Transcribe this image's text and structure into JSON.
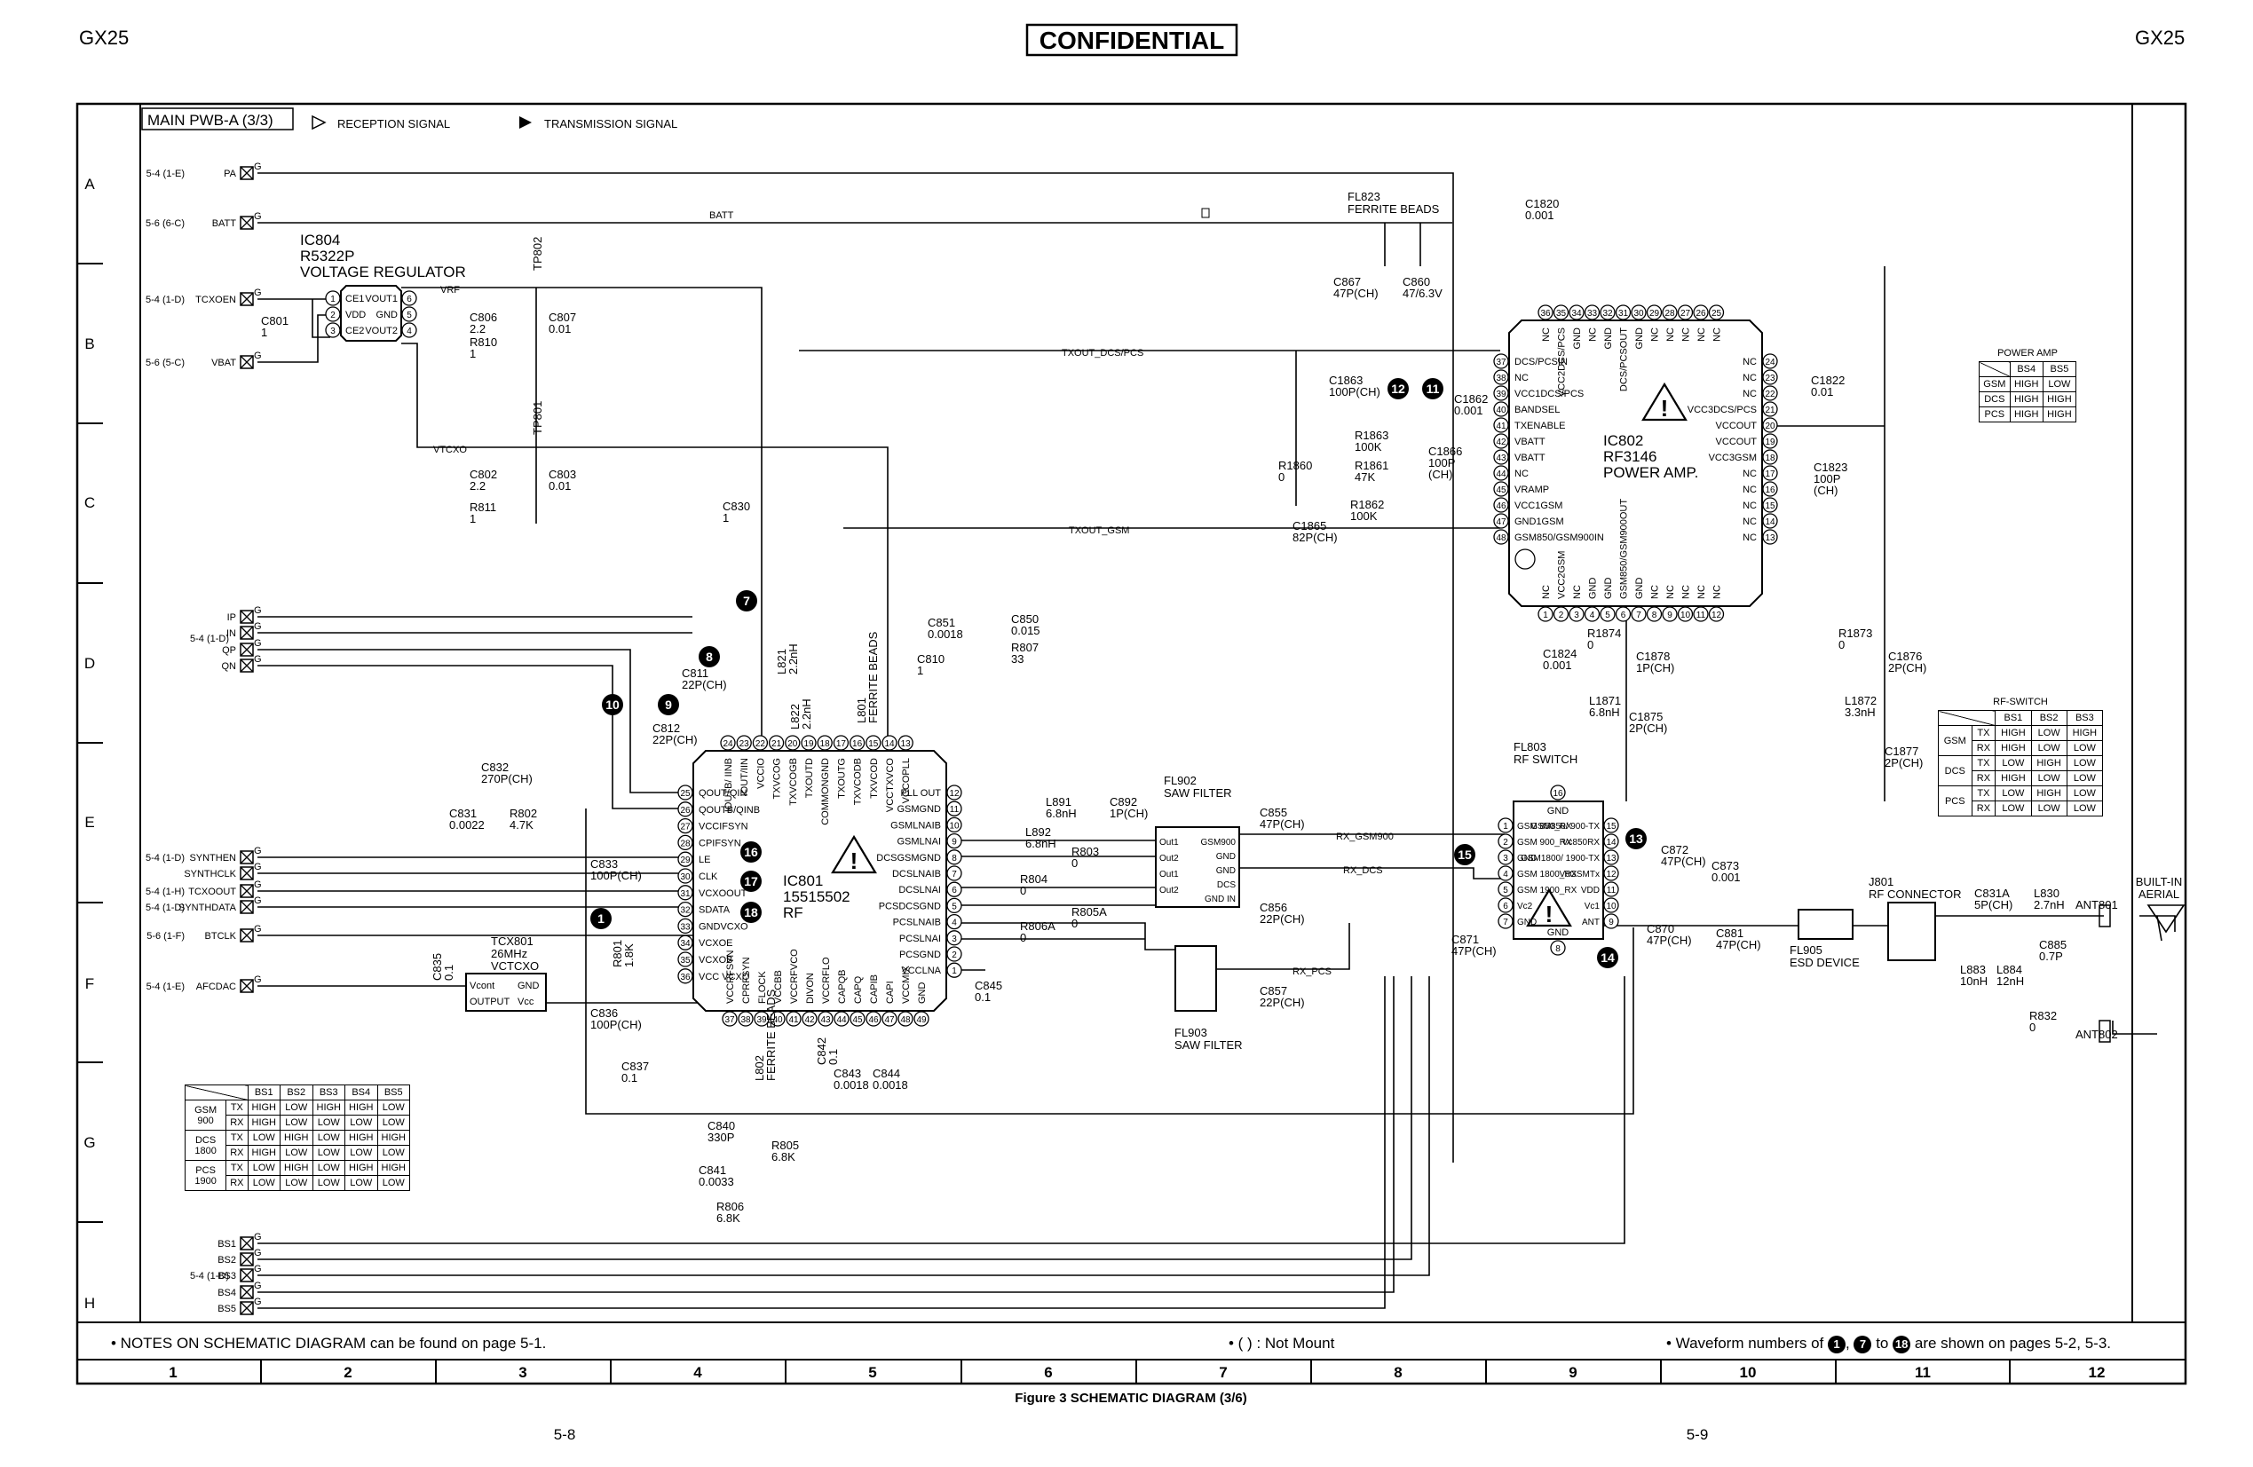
{
  "header": {
    "model_left": "GX25",
    "model_right": "GX25",
    "confidential": "CONFIDENTIAL"
  },
  "frame": {
    "sheet_title": "MAIN PWB-A (3/3)",
    "legend_reception": "RECEPTION SIGNAL",
    "legend_transmission": "TRANSMISSION SIGNAL",
    "rows": [
      "A",
      "B",
      "C",
      "D",
      "E",
      "F",
      "G",
      "H"
    ],
    "cols": [
      "1",
      "2",
      "3",
      "4",
      "5",
      "6",
      "7",
      "8",
      "9",
      "10",
      "11",
      "12"
    ]
  },
  "connectors": {
    "pa": [
      "5-4 (1-E)",
      "PA"
    ],
    "batt": [
      "5-6 (6-C)",
      "BATT"
    ],
    "tcxoen": [
      "5-4 (1-D)",
      "TCXOEN"
    ],
    "vbat": [
      "5-6 (5-C)",
      "VBAT"
    ],
    "iq_ref": "5-4 (1-D)",
    "iq": [
      "IP",
      "IN",
      "QP",
      "QN"
    ],
    "synth": [
      [
        "5-4 (1-D)",
        "SYNTHEN"
      ],
      [
        "",
        "SYNTHCLK"
      ],
      [
        "5-4 (1-H)",
        "TCXOOUT"
      ],
      [
        "5-4 (1-D)",
        "SYNTHDATA"
      ]
    ],
    "btclk": [
      "5-6 (1-F)",
      "BTCLK"
    ],
    "afcdac": [
      "5-4 (1-E)",
      "AFCDAC"
    ],
    "bs_ref": "5-4 (1-D)",
    "bs": [
      "BS1",
      "BS2",
      "BS3",
      "BS4",
      "BS5"
    ],
    "ground_mark": "G"
  },
  "nets": {
    "vrf": "VRF",
    "vtcxo": "VTCXO",
    "batt": "BATT",
    "txout_dcs_pcs": "TXOUT_DCS/PCS",
    "txout_gsm": "TXOUT_GSM",
    "rx_gsm900": "RX_GSM900",
    "rx_dcs": "RX_DCS",
    "rx_pcs": "RX_PCS",
    "nc": "NC"
  },
  "ic804": {
    "ref": "IC804",
    "part": "R5322P",
    "desc": "VOLTAGE REGULATOR",
    "left": [
      [
        "1",
        "CE1"
      ],
      [
        "2",
        "VDD"
      ],
      [
        "3",
        "CE2"
      ]
    ],
    "right": [
      [
        "6",
        "VOUT1"
      ],
      [
        "5",
        "GND"
      ],
      [
        "4",
        "VOUT2"
      ]
    ]
  },
  "ic801": {
    "ref": "IC801",
    "part": "15515502",
    "desc": "RF",
    "top": [
      [
        "24",
        "IOUTB/ IINB"
      ],
      [
        "23",
        "IOUT/IIN"
      ],
      [
        "22",
        "VCCIO"
      ],
      [
        "21",
        "TXVCOG"
      ],
      [
        "20",
        "TXVCOGB"
      ],
      [
        "19",
        "TXOUTD"
      ],
      [
        "18",
        "COMMONGND"
      ],
      [
        "17",
        "TXOUTG"
      ],
      [
        "16",
        "TXVCODB"
      ],
      [
        "15",
        "TXVCOD"
      ],
      [
        "14",
        "VCCTXVCO"
      ],
      [
        "13",
        "VCCOPLL"
      ]
    ],
    "left": [
      [
        "25",
        "QOUT/QIN"
      ],
      [
        "26",
        "QOUTB/QINB"
      ],
      [
        "27",
        "VCCIFSYN"
      ],
      [
        "28",
        "CPIFSYN"
      ],
      [
        "29",
        "LE"
      ],
      [
        "30",
        "CLK"
      ],
      [
        "31",
        "VCXOOUT"
      ],
      [
        "32",
        "SDATA"
      ],
      [
        "33",
        "GNDVCXO"
      ],
      [
        "34",
        "VCXOE"
      ],
      [
        "35",
        "VCXOB"
      ],
      [
        "36",
        "VCC VCXO"
      ]
    ],
    "bottom": [
      [
        "37",
        "VCCRFSYN"
      ],
      [
        "38",
        "CPRFSYN"
      ],
      [
        "39",
        "FLOCK"
      ],
      [
        "40",
        "VCCBB"
      ],
      [
        "41",
        "VCCRFVCO"
      ],
      [
        "42",
        "DIVON"
      ],
      [
        "43",
        "VCCRFLO"
      ],
      [
        "44",
        "CAPQB"
      ],
      [
        "45",
        "CAPQ"
      ],
      [
        "46",
        "CAPIB"
      ],
      [
        "47",
        "CAPI"
      ],
      [
        "48",
        "VCCMIX"
      ],
      [
        "49",
        "GND"
      ]
    ],
    "right": [
      [
        "12",
        "PLL OUT"
      ],
      [
        "11",
        "GSMGND"
      ],
      [
        "10",
        "GSMLNAIB"
      ],
      [
        "9",
        "GSMLNAI"
      ],
      [
        "8",
        "DCSGSMGND"
      ],
      [
        "7",
        "DCSLNAIB"
      ],
      [
        "6",
        "DCSLNAI"
      ],
      [
        "5",
        "PCSDCSGND"
      ],
      [
        "4",
        "PCSLNAIB"
      ],
      [
        "3",
        "PCSLNAI"
      ],
      [
        "2",
        "PCSGND"
      ],
      [
        "1",
        "VCCLNA"
      ]
    ]
  },
  "ic802": {
    "ref": "IC802",
    "part": "RF3146",
    "desc": "POWER AMP.",
    "top": [
      [
        "36",
        "NC"
      ],
      [
        "35",
        "VCC2DCS/PCS"
      ],
      [
        "34",
        "GND"
      ],
      [
        "33",
        "NC"
      ],
      [
        "32",
        "GND"
      ],
      [
        "31",
        "DCS/PCSOUT"
      ],
      [
        "30",
        "GND"
      ],
      [
        "29",
        "NC"
      ],
      [
        "28",
        "NC"
      ],
      [
        "27",
        "NC"
      ],
      [
        "26",
        "NC"
      ],
      [
        "25",
        "NC"
      ]
    ],
    "left": [
      [
        "37",
        "DCS/PCSIN"
      ],
      [
        "38",
        "NC"
      ],
      [
        "39",
        "VCC1DCS/PCS"
      ],
      [
        "40",
        "BANDSEL"
      ],
      [
        "41",
        "TXENABLE"
      ],
      [
        "42",
        "VBATT"
      ],
      [
        "43",
        "VBATT"
      ],
      [
        "44",
        "NC"
      ],
      [
        "45",
        "VRAMP"
      ],
      [
        "46",
        "VCC1GSM"
      ],
      [
        "47",
        "GND1GSM"
      ],
      [
        "48",
        "GSM850/GSM900IN"
      ]
    ],
    "bottom": [
      [
        "1",
        "NC"
      ],
      [
        "2",
        "VCC2GSM"
      ],
      [
        "3",
        "NC"
      ],
      [
        "4",
        "GND"
      ],
      [
        "5",
        "GND"
      ],
      [
        "6",
        "GSM850/GSM900OUT"
      ],
      [
        "7",
        "GND"
      ],
      [
        "8",
        "NC"
      ],
      [
        "9",
        "NC"
      ],
      [
        "10",
        "NC"
      ],
      [
        "11",
        "NC"
      ],
      [
        "12",
        "NC"
      ]
    ],
    "right": [
      [
        "24",
        "NC"
      ],
      [
        "23",
        "NC"
      ],
      [
        "22",
        "NC"
      ],
      [
        "21",
        "VCC3DCS/PCS"
      ],
      [
        "20",
        "VCCOUT"
      ],
      [
        "19",
        "VCCOUT"
      ],
      [
        "18",
        "VCC3GSM"
      ],
      [
        "17",
        "NC"
      ],
      [
        "16",
        "NC"
      ],
      [
        "15",
        "NC"
      ],
      [
        "14",
        "NC"
      ],
      [
        "13",
        "NC"
      ]
    ]
  },
  "fl803": {
    "ref": "FL803",
    "desc": "RF SWITCH",
    "gnd": "GND",
    "left": [
      [
        "1",
        "GSM 850_RX"
      ],
      [
        "2",
        "GSM 900_RX"
      ],
      [
        "3",
        "GND"
      ],
      [
        "4",
        "GSM 1800_RX"
      ],
      [
        "5",
        "GSM 1900_RX"
      ],
      [
        "6",
        "Vc2"
      ],
      [
        "7",
        "GND"
      ]
    ],
    "right": [
      [
        "15",
        "GSM850/ 900-TX"
      ],
      [
        "14",
        "Vc850RX"
      ],
      [
        "13",
        "GSM1800/ 1900-TX"
      ],
      [
        "12",
        "VcGSMTx"
      ],
      [
        "11",
        "VDD"
      ],
      [
        "10",
        "Vc1"
      ],
      [
        "9",
        "ANT"
      ]
    ],
    "top": "16",
    "bottom": "8"
  },
  "fl902": {
    "ref": "FL902",
    "desc": "SAW FILTER",
    "pins": [
      "Out1",
      "Out2",
      "Out1",
      "Out2",
      "GSM900",
      "GND",
      "GND",
      "DCS",
      "GND IN"
    ]
  },
  "fl903": {
    "ref": "FL903",
    "desc": "SAW FILTER"
  },
  "tcx801": {
    "ref": "TCX801",
    "freq": "26MHz",
    "desc": "VCTCXO",
    "pins": [
      "Vcont",
      "GND",
      "OUTPUT",
      "Vcc"
    ]
  },
  "fl823": [
    "FL823",
    "FERRITE BEADS"
  ],
  "j801": [
    "J801",
    "RF CONNECTOR"
  ],
  "fl905": [
    "FL905",
    "ESD DEVICE"
  ],
  "ant801": "ANT801",
  "ant802": "ANT802",
  "aerial": [
    "BUILT-IN",
    "AERIAL"
  ],
  "parts": {
    "C1820": [
      "C1820",
      "0.001"
    ],
    "C867": [
      "C867",
      "47P(CH)"
    ],
    "C860": [
      "C860",
      "47/6.3V"
    ],
    "C806": [
      "C806",
      "2.2"
    ],
    "R810": [
      "R810",
      "1"
    ],
    "C807": [
      "C807",
      "0.01"
    ],
    "C802": [
      "C802",
      "2.2"
    ],
    "R811": [
      "R811",
      "1"
    ],
    "C803": [
      "C803",
      "0.01"
    ],
    "C801": [
      "C801",
      "1"
    ],
    "C830": [
      "C830",
      "1"
    ],
    "C1863": [
      "C1863",
      "100P(CH)"
    ],
    "R1863": [
      "R1863",
      "100K"
    ],
    "C1862": [
      "C1862",
      "0.001"
    ],
    "C1866": [
      "C1866",
      "100P",
      "(CH)"
    ],
    "R1860": [
      "R1860",
      "0"
    ],
    "R1861": [
      "R1861",
      "47K"
    ],
    "R1862": [
      "R1862",
      "100K"
    ],
    "C1865": [
      "C1865",
      "82P(CH)"
    ],
    "C1822": [
      "C1822",
      "0.01"
    ],
    "C1823": [
      "C1823",
      "100P",
      "(CH)"
    ],
    "C851": [
      "C851",
      "0.0018"
    ],
    "C850": [
      "C850",
      "0.015"
    ],
    "R807": [
      "R807",
      "33"
    ],
    "C810": [
      "C810",
      "1"
    ],
    "C811": [
      "C811",
      "22P(CH)"
    ],
    "C812": [
      "C812",
      "22P(CH)"
    ],
    "C832": [
      "C832",
      "270P(CH)"
    ],
    "C831": [
      "C831",
      "0.0022"
    ],
    "R802": [
      "R802",
      "4.7K"
    ],
    "C833": [
      "C833",
      "100P(CH)"
    ],
    "C836": [
      "C836",
      "100P(CH)"
    ],
    "C837": [
      "C837",
      "0.1"
    ],
    "C840": [
      "C840",
      "330P"
    ],
    "R805": [
      "R805",
      "6.8K"
    ],
    "C841": [
      "C841",
      "0.0033"
    ],
    "R806": [
      "R806",
      "6.8K"
    ],
    "C843": [
      "C843",
      "0.0018"
    ],
    "C844": [
      "C844",
      "0.0018"
    ],
    "C845": [
      "C845",
      "0.1"
    ],
    "L891": [
      "L891",
      "6.8nH"
    ],
    "C892": [
      "C892",
      "1P(CH)"
    ],
    "L892": [
      "L892",
      "6.8nH"
    ],
    "R803": [
      "R803",
      "0"
    ],
    "R804": [
      "R804",
      "0"
    ],
    "R805A": [
      "R805A",
      "0"
    ],
    "R806A": [
      "R806A",
      "0"
    ],
    "C855": [
      "C855",
      "47P(CH)"
    ],
    "C856": [
      "C856",
      "22P(CH)"
    ],
    "C857": [
      "C857",
      "22P(CH)"
    ],
    "C1824": [
      "C1824",
      "0.001"
    ],
    "R1874": [
      "R1874",
      "0"
    ],
    "C1878": [
      "C1878",
      "1P(CH)"
    ],
    "L1871": [
      "L1871",
      "6.8nH"
    ],
    "C1875": [
      "C1875",
      "2P(CH)"
    ],
    "R1873": [
      "R1873",
      "0"
    ],
    "C1876": [
      "C1876",
      "2P(CH)"
    ],
    "L1872": [
      "L1872",
      "3.3nH"
    ],
    "C1877": [
      "C1877",
      "2P(CH)"
    ],
    "C872": [
      "C872",
      "47P(CH)"
    ],
    "C873": [
      "C873",
      "0.001"
    ],
    "C871": [
      "C871",
      "47P(CH)"
    ],
    "C870": [
      "C870",
      "47P(CH)"
    ],
    "C881": [
      "C881",
      "47P(CH)"
    ],
    "C831A": [
      "C831A",
      "5P(CH)"
    ],
    "L830": [
      "L830",
      "2.7nH"
    ],
    "C885": [
      "C885",
      "0.7P"
    ],
    "L883": [
      "L883",
      "10nH"
    ],
    "L884": [
      "L884",
      "12nH"
    ],
    "R832": [
      "R832",
      "0"
    ],
    "L801": [
      "L801",
      "FERRITE BEADS"
    ],
    "L821": [
      "L821",
      "2.2nH"
    ],
    "L822": [
      "L822",
      "2.2nH"
    ],
    "R801": [
      "R801",
      "1.8K"
    ],
    "C835": [
      "C835",
      "0.1"
    ],
    "C842": [
      "C842",
      "0.1"
    ],
    "L802": [
      "L802",
      "FERRITE BEADS"
    ],
    "TP802": [
      "TP802"
    ],
    "TP801": [
      "TP801"
    ]
  },
  "waveform_markers": [
    "1",
    "7",
    "8",
    "9",
    "10",
    "11",
    "12",
    "13",
    "14",
    "15",
    "16",
    "17",
    "18"
  ],
  "bs_table": {
    "headers": [
      "BS1",
      "BS2",
      "BS3",
      "BS4",
      "BS5"
    ],
    "groups": [
      {
        "band": "GSM 900",
        "rows": [
          [
            "TX",
            "HIGH",
            "LOW",
            "HIGH",
            "HIGH",
            "LOW"
          ],
          [
            "RX",
            "HIGH",
            "LOW",
            "LOW",
            "LOW",
            "LOW"
          ]
        ]
      },
      {
        "band": "DCS 1800",
        "rows": [
          [
            "TX",
            "LOW",
            "HIGH",
            "LOW",
            "HIGH",
            "HIGH"
          ],
          [
            "RX",
            "HIGH",
            "LOW",
            "LOW",
            "LOW",
            "LOW"
          ]
        ]
      },
      {
        "band": "PCS 1900",
        "rows": [
          [
            "TX",
            "LOW",
            "HIGH",
            "LOW",
            "HIGH",
            "HIGH"
          ],
          [
            "RX",
            "LOW",
            "LOW",
            "LOW",
            "LOW",
            "LOW"
          ]
        ]
      }
    ]
  },
  "rf_switch_table": {
    "title": "RF-SWITCH",
    "headers": [
      "BS1",
      "BS2",
      "BS3"
    ],
    "groups": [
      {
        "band": "GSM",
        "rows": [
          [
            "TX",
            "HIGH",
            "LOW",
            "HIGH"
          ],
          [
            "RX",
            "HIGH",
            "LOW",
            "LOW"
          ]
        ]
      },
      {
        "band": "DCS",
        "rows": [
          [
            "TX",
            "LOW",
            "HIGH",
            "LOW"
          ],
          [
            "RX",
            "HIGH",
            "LOW",
            "LOW"
          ]
        ]
      },
      {
        "band": "PCS",
        "rows": [
          [
            "TX",
            "LOW",
            "HIGH",
            "LOW"
          ],
          [
            "RX",
            "LOW",
            "LOW",
            "LOW"
          ]
        ]
      }
    ]
  },
  "power_amp_table": {
    "title": "POWER AMP",
    "headers": [
      "BS4",
      "BS5"
    ],
    "rows": [
      [
        "GSM",
        "HIGH",
        "LOW"
      ],
      [
        "DCS",
        "HIGH",
        "HIGH"
      ],
      [
        "PCS",
        "HIGH",
        "HIGH"
      ]
    ]
  },
  "notes": {
    "schematic": "• NOTES ON SCHEMATIC DIAGRAM can be found on page 5-1.",
    "not_mount": "• (     ) : Not Mount",
    "waveform_pre": "• Waveform numbers of",
    "waveform_m1": "1",
    "waveform_sep": ",",
    "waveform_m2": "7",
    "waveform_to": "to",
    "waveform_m3": "18",
    "waveform_post": "are shown on pages 5-2, 5-3."
  },
  "footer": {
    "caption": "Figure 3 SCHEMATIC DIAGRAM (3/6)",
    "page_left": "5-8",
    "page_right": "5-9"
  }
}
